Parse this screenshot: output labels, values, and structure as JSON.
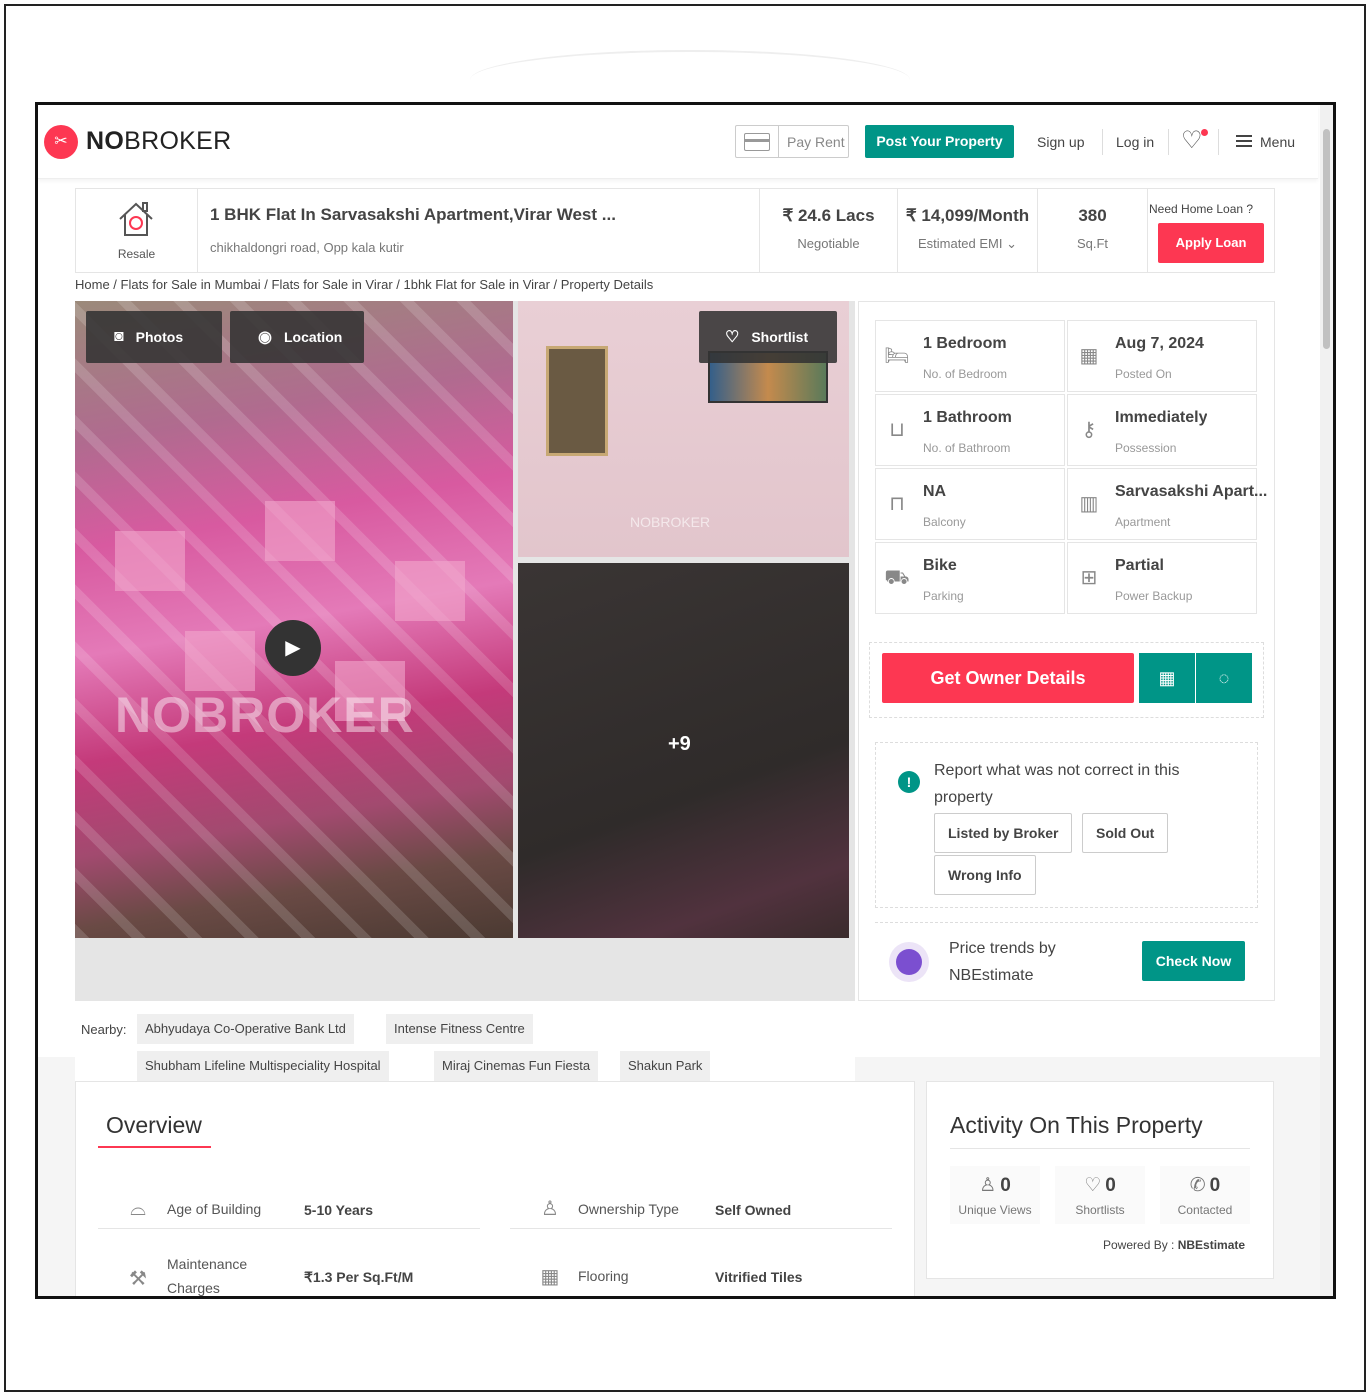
{
  "header": {
    "logo_text_bold": "NO",
    "logo_text_rest": "BROKER",
    "pay_rent": "Pay Rent",
    "post_property": "Post Your Property",
    "sign_up": "Sign up",
    "log_in": "Log in",
    "menu": "Menu"
  },
  "title_bar": {
    "type": "Resale",
    "title": "1 BHK Flat In Sarvasakshi Apartment,Virar West ...",
    "address": "chikhaldongri road, Opp kala kutir",
    "price": "₹ 24.6 Lacs",
    "price_sub": "Negotiable",
    "emi": "₹ 14,099/Month",
    "emi_sub": "Estimated EMI",
    "area": "380",
    "area_sub": "Sq.Ft",
    "loan_question": "Need Home Loan ?",
    "apply_loan": "Apply Loan"
  },
  "breadcrumb": "Home / Flats for Sale in Mumbai / Flats for Sale in Virar / 1bhk Flat for Sale in Virar / Property Details",
  "gallery": {
    "photos": "Photos",
    "location": "Location",
    "shortlist": "Shortlist",
    "more_count": "+9",
    "watermark": "NOBROKER"
  },
  "details": [
    {
      "value": "1 Bedroom",
      "label": "No. of Bedroom",
      "icon": "bed-icon"
    },
    {
      "value": "Aug 7, 2024",
      "label": "Posted On",
      "icon": "calendar-icon"
    },
    {
      "value": "1 Bathroom",
      "label": "No. of Bathroom",
      "icon": "bathtub-icon"
    },
    {
      "value": "Immediately",
      "label": "Possession",
      "icon": "key-icon"
    },
    {
      "value": "NA",
      "label": "Balcony",
      "icon": "balcony-icon"
    },
    {
      "value": "Sarvasakshi Apart...",
      "label": "Apartment",
      "icon": "building-icon"
    },
    {
      "value": "Bike",
      "label": "Parking",
      "icon": "car-icon"
    },
    {
      "value": "Partial",
      "label": "Power Backup",
      "icon": "battery-icon"
    }
  ],
  "cta": {
    "owner_details": "Get Owner Details"
  },
  "report": {
    "text": "Report what was not correct in this property",
    "chips": [
      "Listed by Broker",
      "Sold Out",
      "Wrong Info"
    ]
  },
  "trends": {
    "text_line1": "Price trends by",
    "text_line2": "NBEstimate",
    "button": "Check Now"
  },
  "nearby": {
    "label": "Nearby:",
    "places": [
      "Abhyudaya Co-Operative Bank Ltd",
      "Intense Fitness Centre",
      "Shubham Lifeline Multispeciality Hospital",
      "Miraj Cinemas Fun Fiesta",
      "Shakun Park"
    ]
  },
  "overview": {
    "title": "Overview",
    "rows": [
      {
        "label": "Age of Building",
        "value": "5-10 Years",
        "icon": "cake-icon"
      },
      {
        "label": "Ownership Type",
        "value": "Self Owned",
        "icon": "owner-icon"
      },
      {
        "label": "Maintenance Charges",
        "value": "₹1.3 Per Sq.Ft/M",
        "icon": "tools-icon"
      },
      {
        "label": "Flooring",
        "value": "Vitrified Tiles",
        "icon": "tiles-icon"
      }
    ]
  },
  "activity": {
    "title": "Activity On This Property",
    "stats": [
      {
        "count": "0",
        "label": "Unique Views",
        "icon": "person-icon"
      },
      {
        "count": "0",
        "label": "Shortlists",
        "icon": "heart-icon"
      },
      {
        "count": "0",
        "label": "Contacted",
        "icon": "phone-icon"
      }
    ],
    "powered_label": "Powered By :",
    "powered_by": "NBEstimate"
  },
  "colors": {
    "brand_red": "#fd3752",
    "brand_green": "#009587"
  }
}
